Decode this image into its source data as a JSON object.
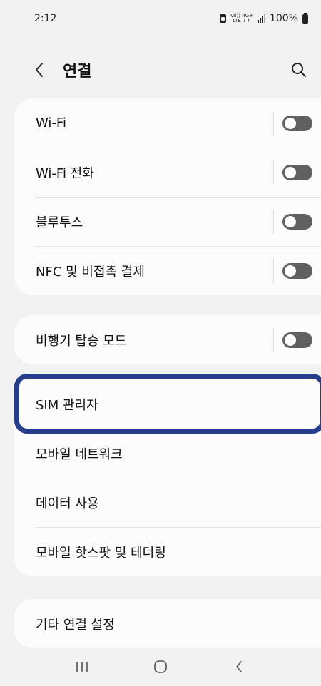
{
  "status_bar": {
    "time": "2:12",
    "net_top": "Vo)) 4G+",
    "net_bottom": "LTE ↓↑",
    "battery": "100%"
  },
  "header": {
    "title": "연결",
    "back_icon": "chevron-left-icon",
    "search_icon": "search-icon"
  },
  "groups": [
    {
      "items": [
        {
          "label": "Wi-Fi",
          "toggle": false
        },
        {
          "label": "Wi-Fi 전화",
          "toggle": false
        },
        {
          "label": "블루투스",
          "toggle": false
        },
        {
          "label": "NFC 및 비접촉 결제",
          "toggle": false
        }
      ]
    },
    {
      "items": [
        {
          "label": "비행기 탑승 모드",
          "toggle": false
        }
      ]
    },
    {
      "items": [
        {
          "label": "SIM 관리자"
        },
        {
          "label": "모바일 네트워크"
        },
        {
          "label": "데이터 사용"
        },
        {
          "label": "모바일 핫스팟 및 테더링"
        }
      ]
    },
    {
      "items": [
        {
          "label": "기타 연결 설정"
        }
      ]
    }
  ],
  "nav_bar": {
    "recents_icon": "recents-icon",
    "home_icon": "home-icon",
    "back_icon": "back-icon"
  },
  "colors": {
    "background": "#f2f2f2",
    "card": "#fcfcfc",
    "toggle_off": "#606060",
    "highlight": "#263d8c"
  }
}
